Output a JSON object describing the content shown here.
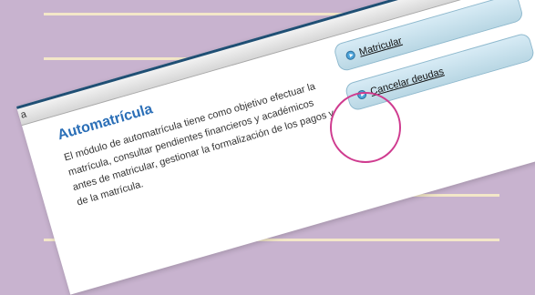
{
  "panel": {
    "tab_letter": "a",
    "title": "Automatrícula",
    "description": "El módulo de automatrícula tiene como objetivo efectuar la matrícula, consultar pendientes financieros y académicos antes de matricular, gestionar la formalización de los pagos y de la matrícula.",
    "actions": [
      {
        "label": "Matricular",
        "icon": "play-circle-icon"
      },
      {
        "label": "Cancelar deudas",
        "icon": "play-circle-icon"
      }
    ]
  },
  "colors": {
    "background": "#c8b3cf",
    "lines": "#f3e7c8",
    "title": "#2b6fb7",
    "bar_border": "#1f4f74",
    "button_fill": "#c9e1ec",
    "highlight_circle": "#cf3b8f"
  }
}
